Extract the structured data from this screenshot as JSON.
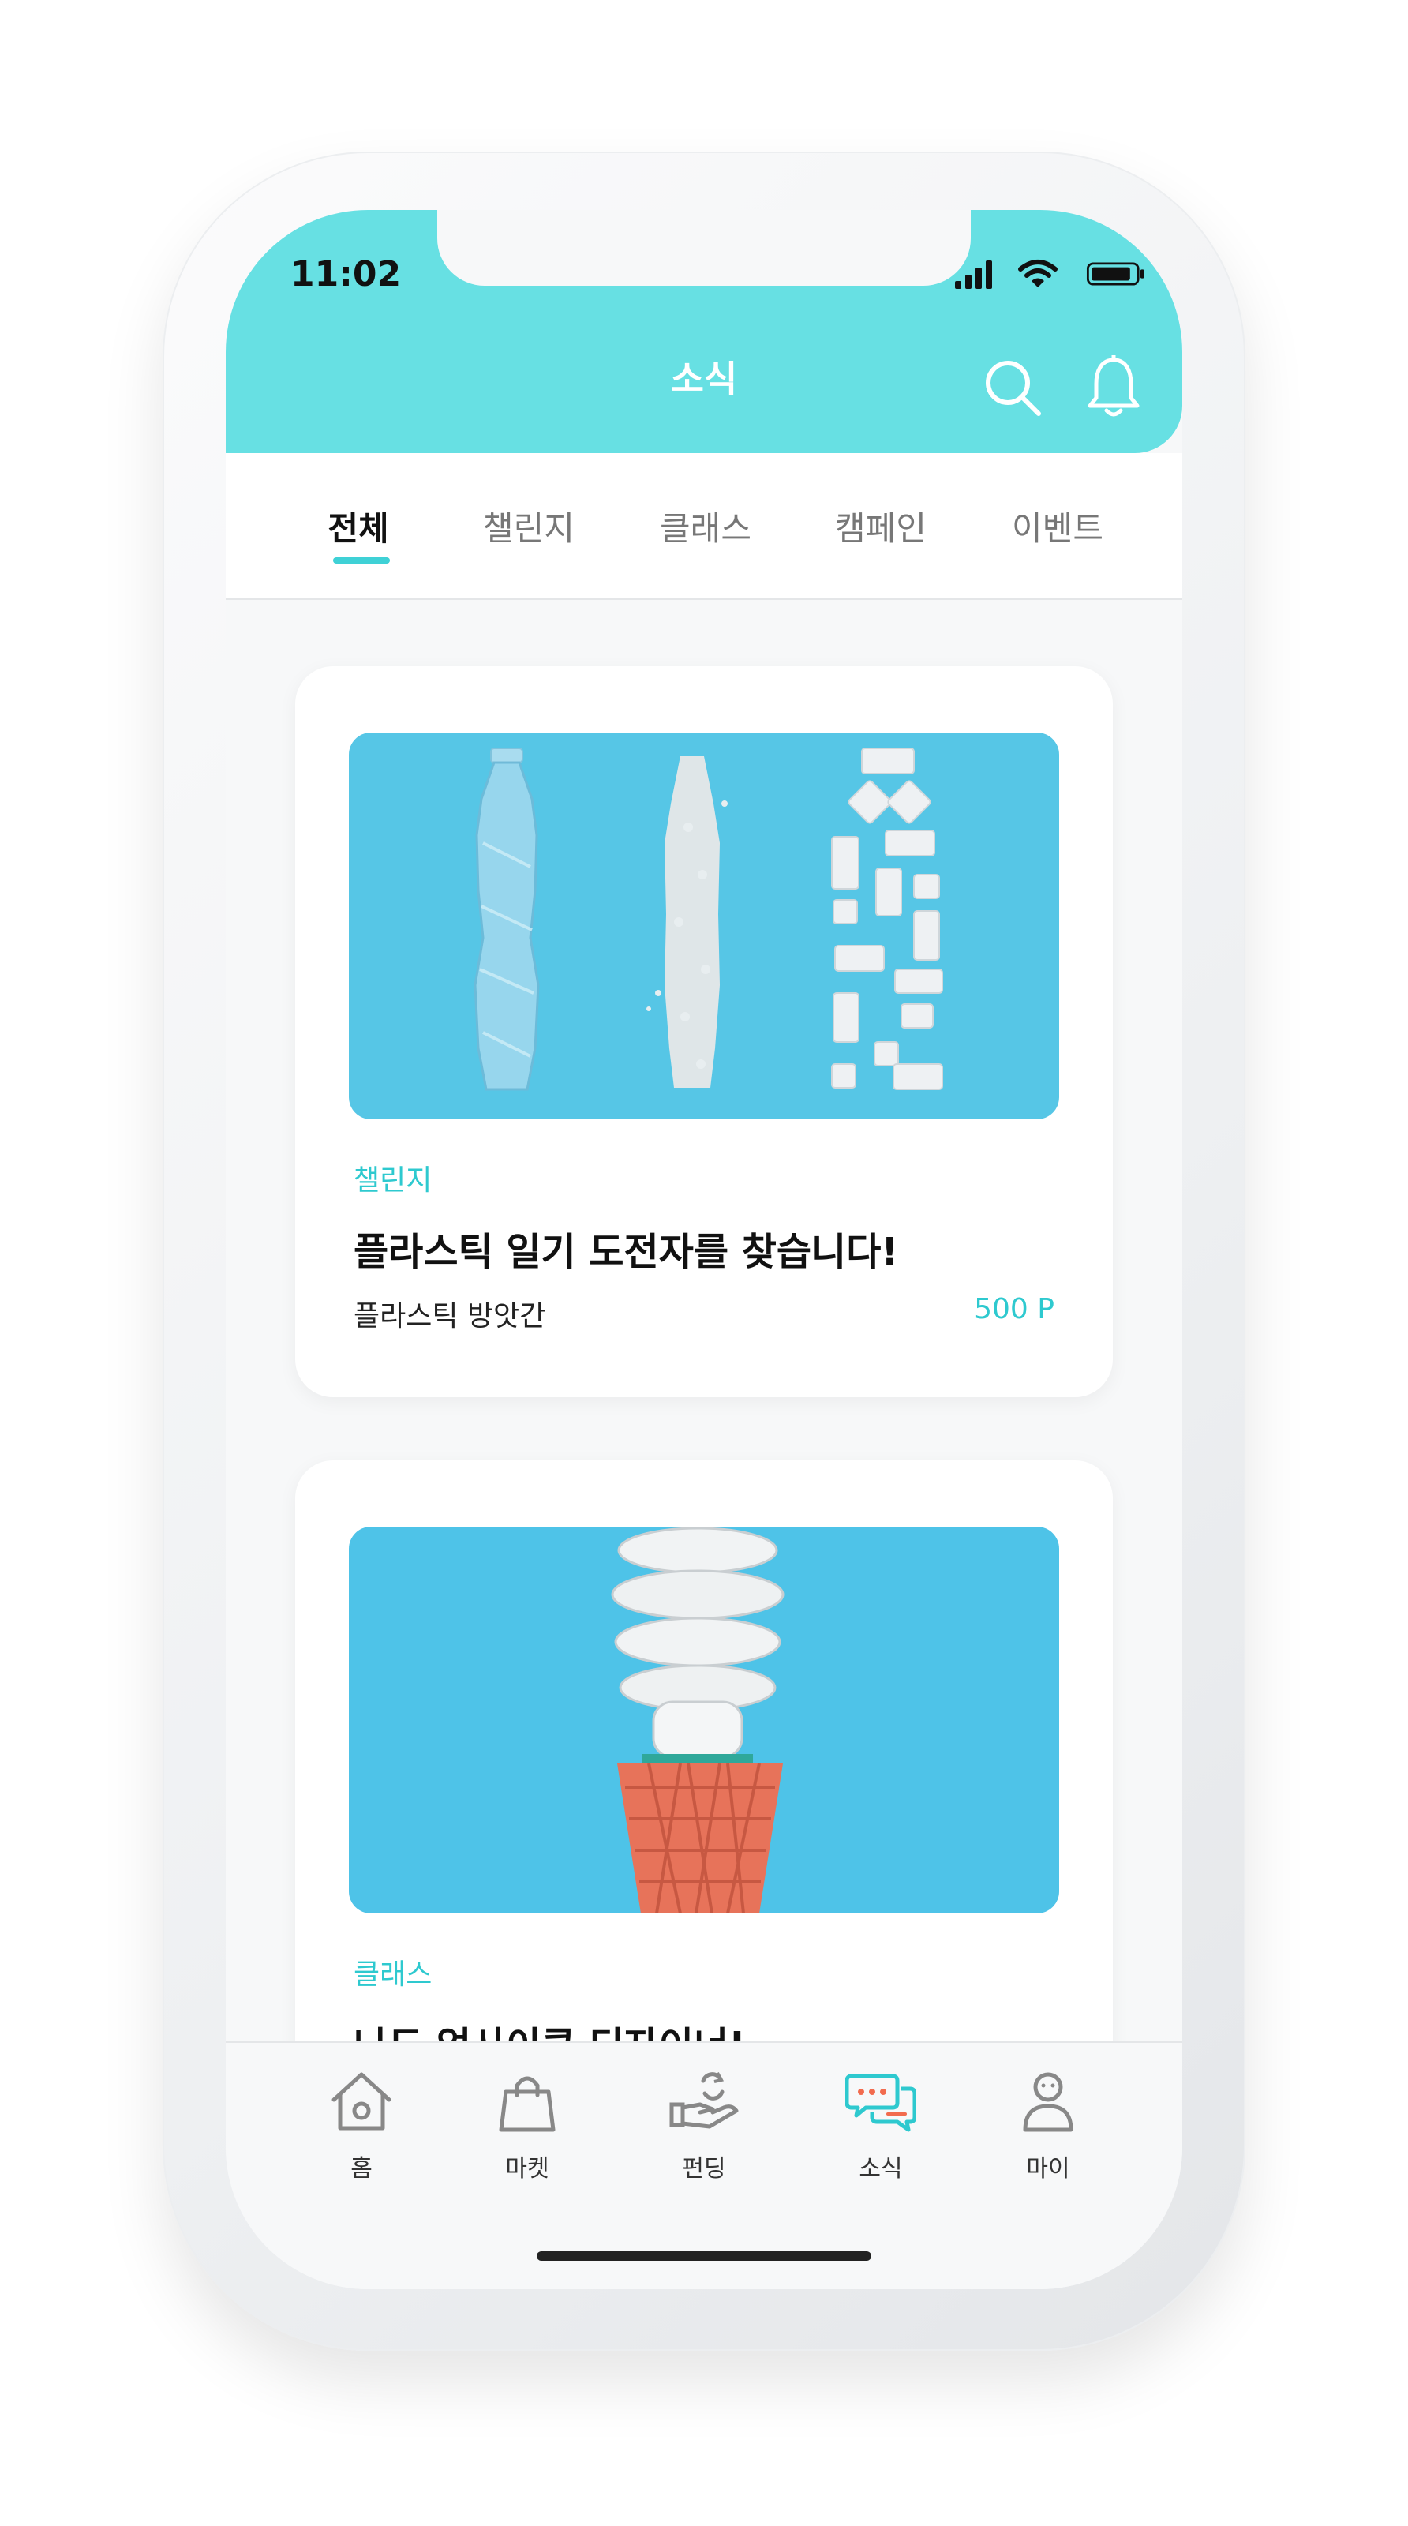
{
  "status_bar": {
    "time": "11:02"
  },
  "header": {
    "title": "소식"
  },
  "tabs": [
    {
      "label": "전체",
      "active": true
    },
    {
      "label": "챌린지",
      "active": false
    },
    {
      "label": "클래스",
      "active": false
    },
    {
      "label": "캠페인",
      "active": false
    },
    {
      "label": "이벤트",
      "active": false
    }
  ],
  "cards": [
    {
      "category": "챌린지",
      "title": "플라스틱 일기 도전자를 찾습니다!",
      "subtitle": "플라스틱 방앗간",
      "points": "500 P",
      "image_icon": "plastic-bottle-recycling-photo"
    },
    {
      "category": "클래스",
      "title": "나도 업사이클 디자이너!",
      "image_icon": "lightbulb-cone-photo"
    }
  ],
  "bottom_nav": [
    {
      "label": "홈",
      "icon": "home-icon",
      "active": false
    },
    {
      "label": "마켓",
      "icon": "shopping-bag-icon",
      "active": false
    },
    {
      "label": "펀딩",
      "icon": "funding-hand-icon",
      "active": false
    },
    {
      "label": "소식",
      "icon": "chat-bubbles-icon",
      "active": true
    },
    {
      "label": "마이",
      "icon": "profile-icon",
      "active": false
    }
  ],
  "colors": {
    "accent": "#67e0e3",
    "accent_text": "#2ec9cf",
    "photo_background": "#56c6e6"
  }
}
